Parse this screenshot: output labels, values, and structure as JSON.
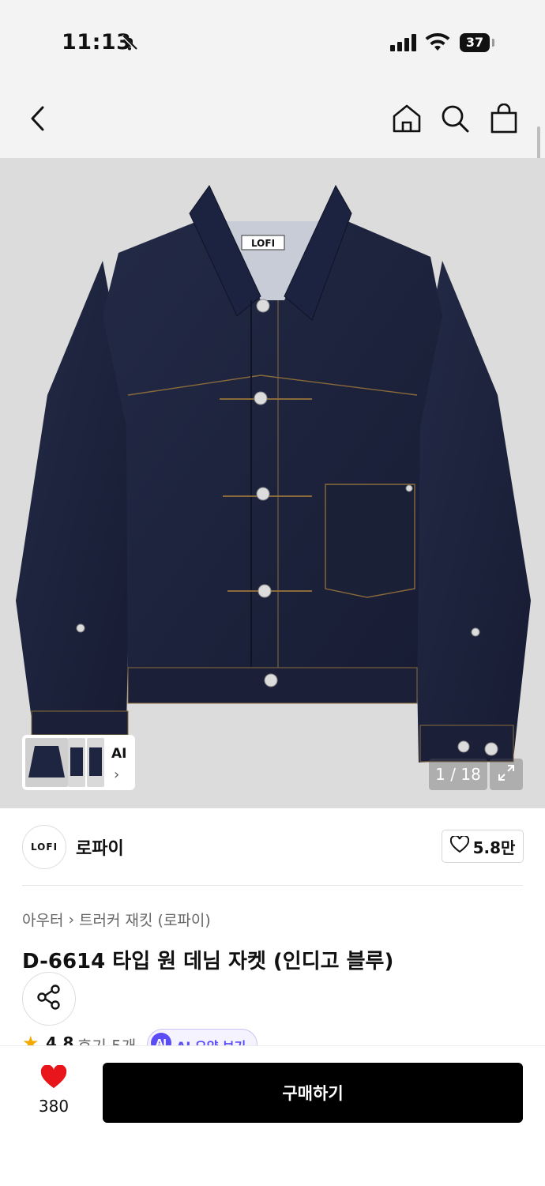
{
  "status_bar": {
    "time": "11:13",
    "battery": "37"
  },
  "product": {
    "image_counter": "1 / 18",
    "thumb_ai_label": "AI",
    "jacket_tag": "LOFI",
    "brand_logo_text": "LOFI",
    "brand_name": "로파이",
    "likes": "5.8만",
    "breadcrumb": [
      "아우터",
      "트러커 재킷 (로파이)"
    ],
    "title": "D-6614 타입 원 데님 자켓 (인디고 블루)",
    "rating": "4.8",
    "reviews": "후기 5개",
    "ai_badge": "AI",
    "ai_summary_label": "AI 요약 보기"
  },
  "bottom_bar": {
    "wishlist_count": "380",
    "buy_label": "구매하기"
  },
  "colors": {
    "accent_purple": "#5b4df5",
    "heart_red": "#e8151b",
    "denim": "#1e2540"
  }
}
